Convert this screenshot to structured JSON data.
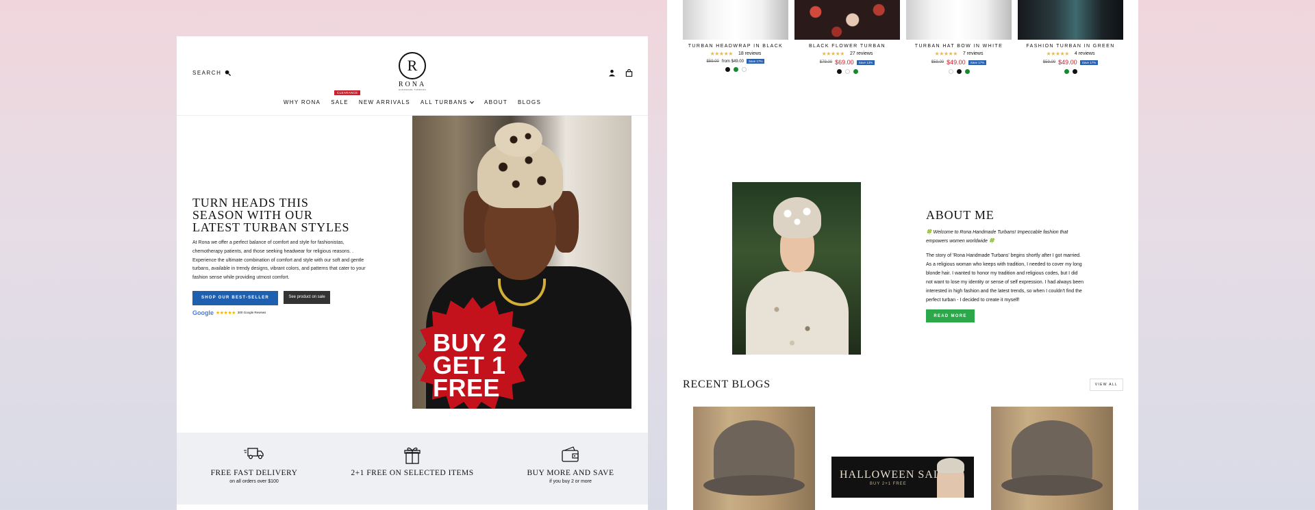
{
  "colors": {
    "accent_blue": "#1f5fb0",
    "sale_red": "#c8202c",
    "green": "#2aa84a",
    "star": "#e8b94a"
  },
  "left": {
    "header": {
      "search_label": "SEARCH",
      "logo_letter": "R",
      "logo_word": "RONA",
      "logo_tagline": "HANDMADE TURBANS",
      "icons": [
        "search-icon",
        "account-icon",
        "cart-icon"
      ]
    },
    "nav": {
      "items": [
        "WHY RONA",
        "SALE",
        "NEW ARRIVALS",
        "ALL TURBANS",
        "ABOUT",
        "BLOGS"
      ],
      "sale_badge": "CLEARANCE",
      "dropdown_icon": "chevron-down-icon"
    },
    "hero": {
      "title_lines": [
        "TURN HEADS THIS",
        "SEASON WITH OUR",
        "LATEST TURBAN STYLES"
      ],
      "description": "At Rona we offer a perfect balance of comfort and style for fashionistas, chemotherapy patients, and those seeking headwear for religious reasons. . Experience the ultimate combination of comfort and style with our soft and gentle turbans, available in trendy designs, vibrant colors, and patterns that cater to your fashion sense while providing utmost comfort.",
      "primary_button": "SHOP OUR BEST-SELLER",
      "secondary_button": "See product on sale",
      "google_label": "Google",
      "review_stars": "★★★★★",
      "review_count": "300 Google Reviews",
      "promo_lines": [
        "BUY 2",
        "GET 1",
        "FREE"
      ]
    },
    "features": [
      {
        "icon": "truck-icon",
        "title": "FREE FAST DELIVERY",
        "subtitle": "on all orders over $100"
      },
      {
        "icon": "gift-icon",
        "title": "2+1 FREE ON SELECTED ITEMS",
        "subtitle": ""
      },
      {
        "icon": "wallet-icon",
        "title": "BUY MORE AND SAVE",
        "subtitle": "if you buy 2 or more"
      }
    ]
  },
  "right": {
    "products": [
      {
        "name": "TURBAN HEADWRAP IN BLACK",
        "stars": "★★★★★",
        "reviews": "18 reviews",
        "old_price": "$59.00",
        "price": "from $49.00",
        "save": "Save 17%",
        "swatches": [
          "#111111",
          "#138a2c",
          "#ffffff"
        ]
      },
      {
        "name": "BLACK FLOWER TURBAN",
        "stars": "★★★★★",
        "reviews": "27 reviews",
        "old_price": "$79.00",
        "price": "$69.00",
        "save": "Save 13%",
        "swatches": [
          "#111111",
          "#ffffff",
          "#138a2c"
        ]
      },
      {
        "name": "TURBAN HAT BOW IN WHITE",
        "stars": "★★★★★",
        "reviews": "7 reviews",
        "old_price": "$59.00",
        "price": "$49.00",
        "save": "Save 17%",
        "swatches": [
          "#ffffff",
          "#111111",
          "#138a2c"
        ]
      },
      {
        "name": "FASHION TURBAN IN GREEN",
        "stars": "★★★★★",
        "reviews": "4 reviews",
        "old_price": "$59.00",
        "price": "$49.00",
        "save": "Save 17%",
        "swatches": [
          "#138a2c",
          "#111111"
        ]
      }
    ],
    "about": {
      "title": "ABOUT ME",
      "intro": "🍀 Welcome to Rona Handmade Turbans! Impeccable fashion that empowers women worldwide 🍀",
      "story": "The story of 'Rona Handmade Turbans' begins shortly after I got married. As a religious woman who keeps with tradition, I needed to cover my long blonde hair. I wanted to honor my tradition and religious codes, but I did not want to lose my identity or sense of self expression. I had always been interested in high fashion and the latest trends, so when I couldn't find the perfect turban - I decided to create it myself!",
      "button": "READ MORE"
    },
    "blogs": {
      "title": "RECENT BLOGS",
      "view_all": "VIEW ALL",
      "halloween_title": "HALLOWEEN SALE",
      "halloween_sub": "BUY 2+1 FREE"
    }
  }
}
